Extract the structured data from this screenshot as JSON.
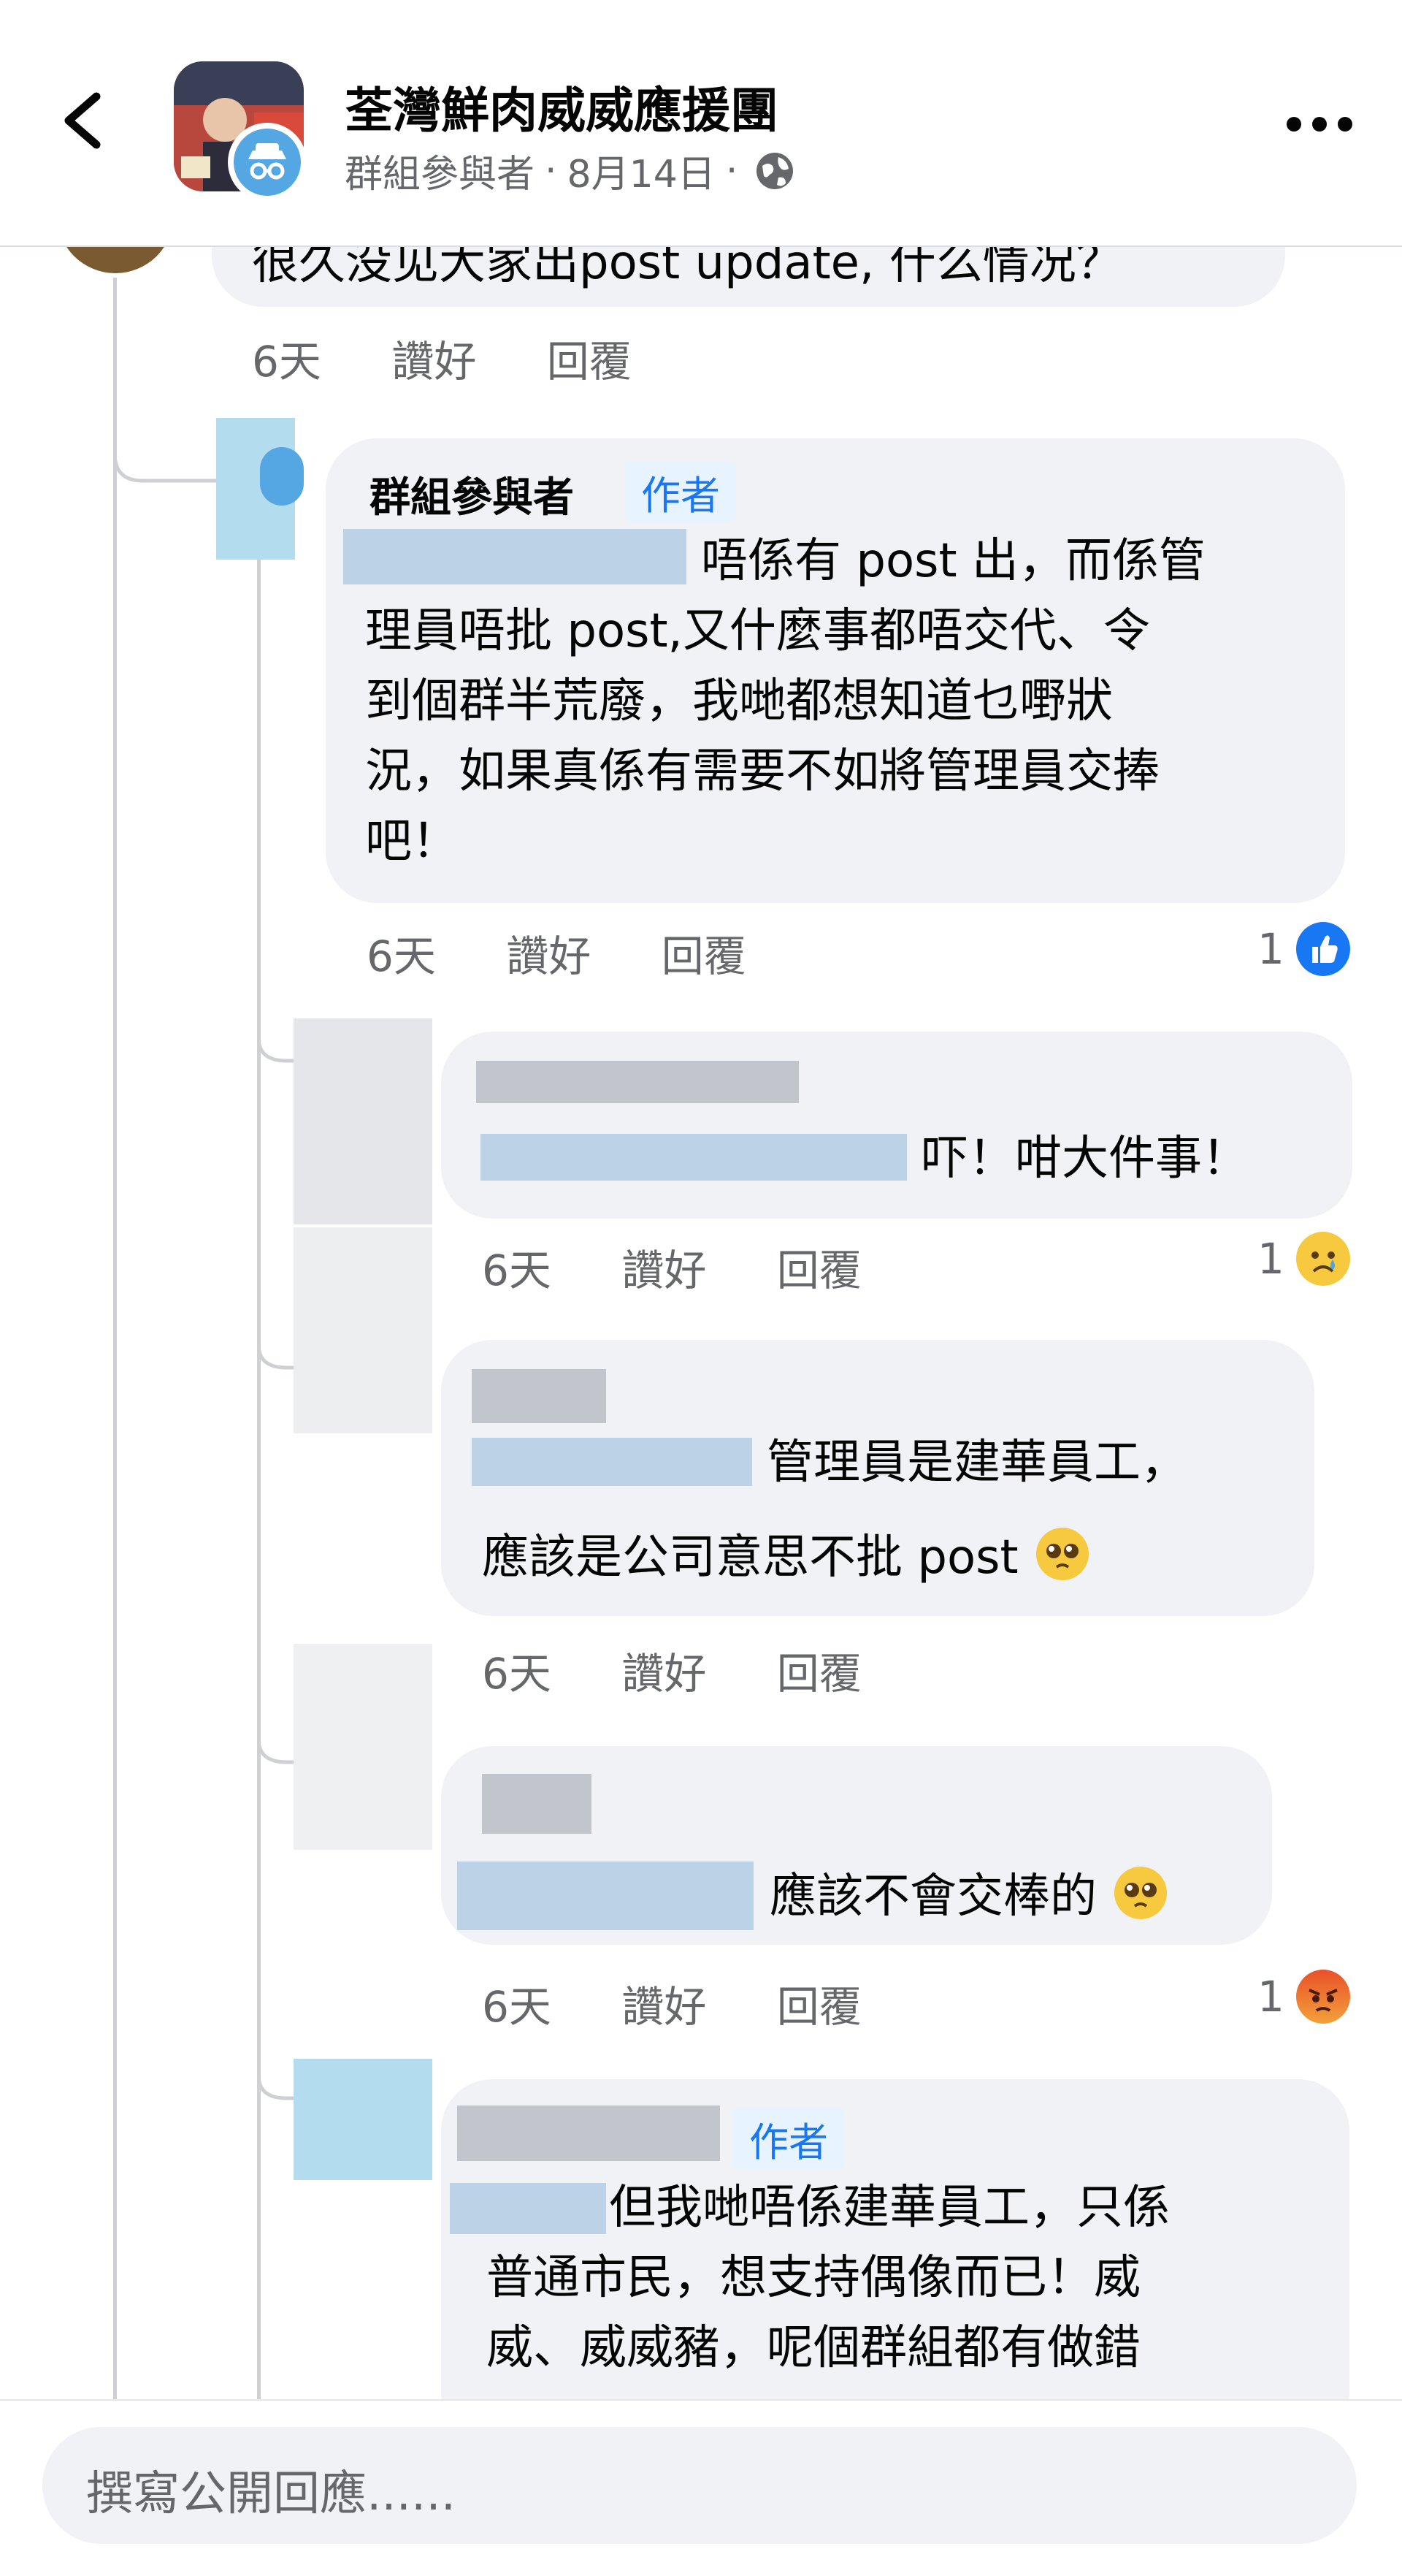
{
  "header": {
    "group_title": "荃灣鮮肉威威應援團",
    "author": "群組參與者",
    "sep1": "·",
    "date": "8月14日",
    "sep2": "·"
  },
  "top_comment": {
    "text": "很久没见大家出post update, 什么情况？",
    "time": "6天",
    "like": "讚好",
    "reply": "回覆"
  },
  "reply1": {
    "name": "群組參與者",
    "tag": "作者",
    "lines": [
      "唔係有 post 出，而係管",
      "理員唔批 post,又什麼事都唔交代、令",
      "到個群半荒廢，我哋都想知道乜嘢狀",
      "況，如果真係有需要不如將管理員交捧",
      "吧！"
    ],
    "time": "6天",
    "like": "讚好",
    "reply": "回覆",
    "reaction_count": "1",
    "reaction_icon": "like-icon"
  },
  "reply2": {
    "text": "吓！咁大件事！",
    "time": "6天",
    "like": "讚好",
    "reply": "回覆",
    "reaction_count": "1",
    "reaction_icon": "sad-icon"
  },
  "reply3": {
    "lines": [
      "管理員是建華員工，",
      "應該是公司意思不批 post"
    ],
    "time": "6天",
    "like": "讚好",
    "reply": "回覆"
  },
  "reply4": {
    "text": "應該不會交棒的",
    "time": "6天",
    "like": "讚好",
    "reply": "回覆",
    "reaction_count": "1",
    "reaction_icon": "angry-icon"
  },
  "reply5": {
    "tag": "作者",
    "lines": [
      "但我哋唔係建華員工，只係",
      "普通市民，想支持偶像而已！威",
      "威、威威豬，呢個群組都有做錯"
    ]
  },
  "composer": {
    "placeholder": "撰寫公開回應......"
  },
  "colors": {
    "accent": "#1877f2",
    "bubble": "#f0f2f5",
    "secondary_text": "#65676b"
  }
}
